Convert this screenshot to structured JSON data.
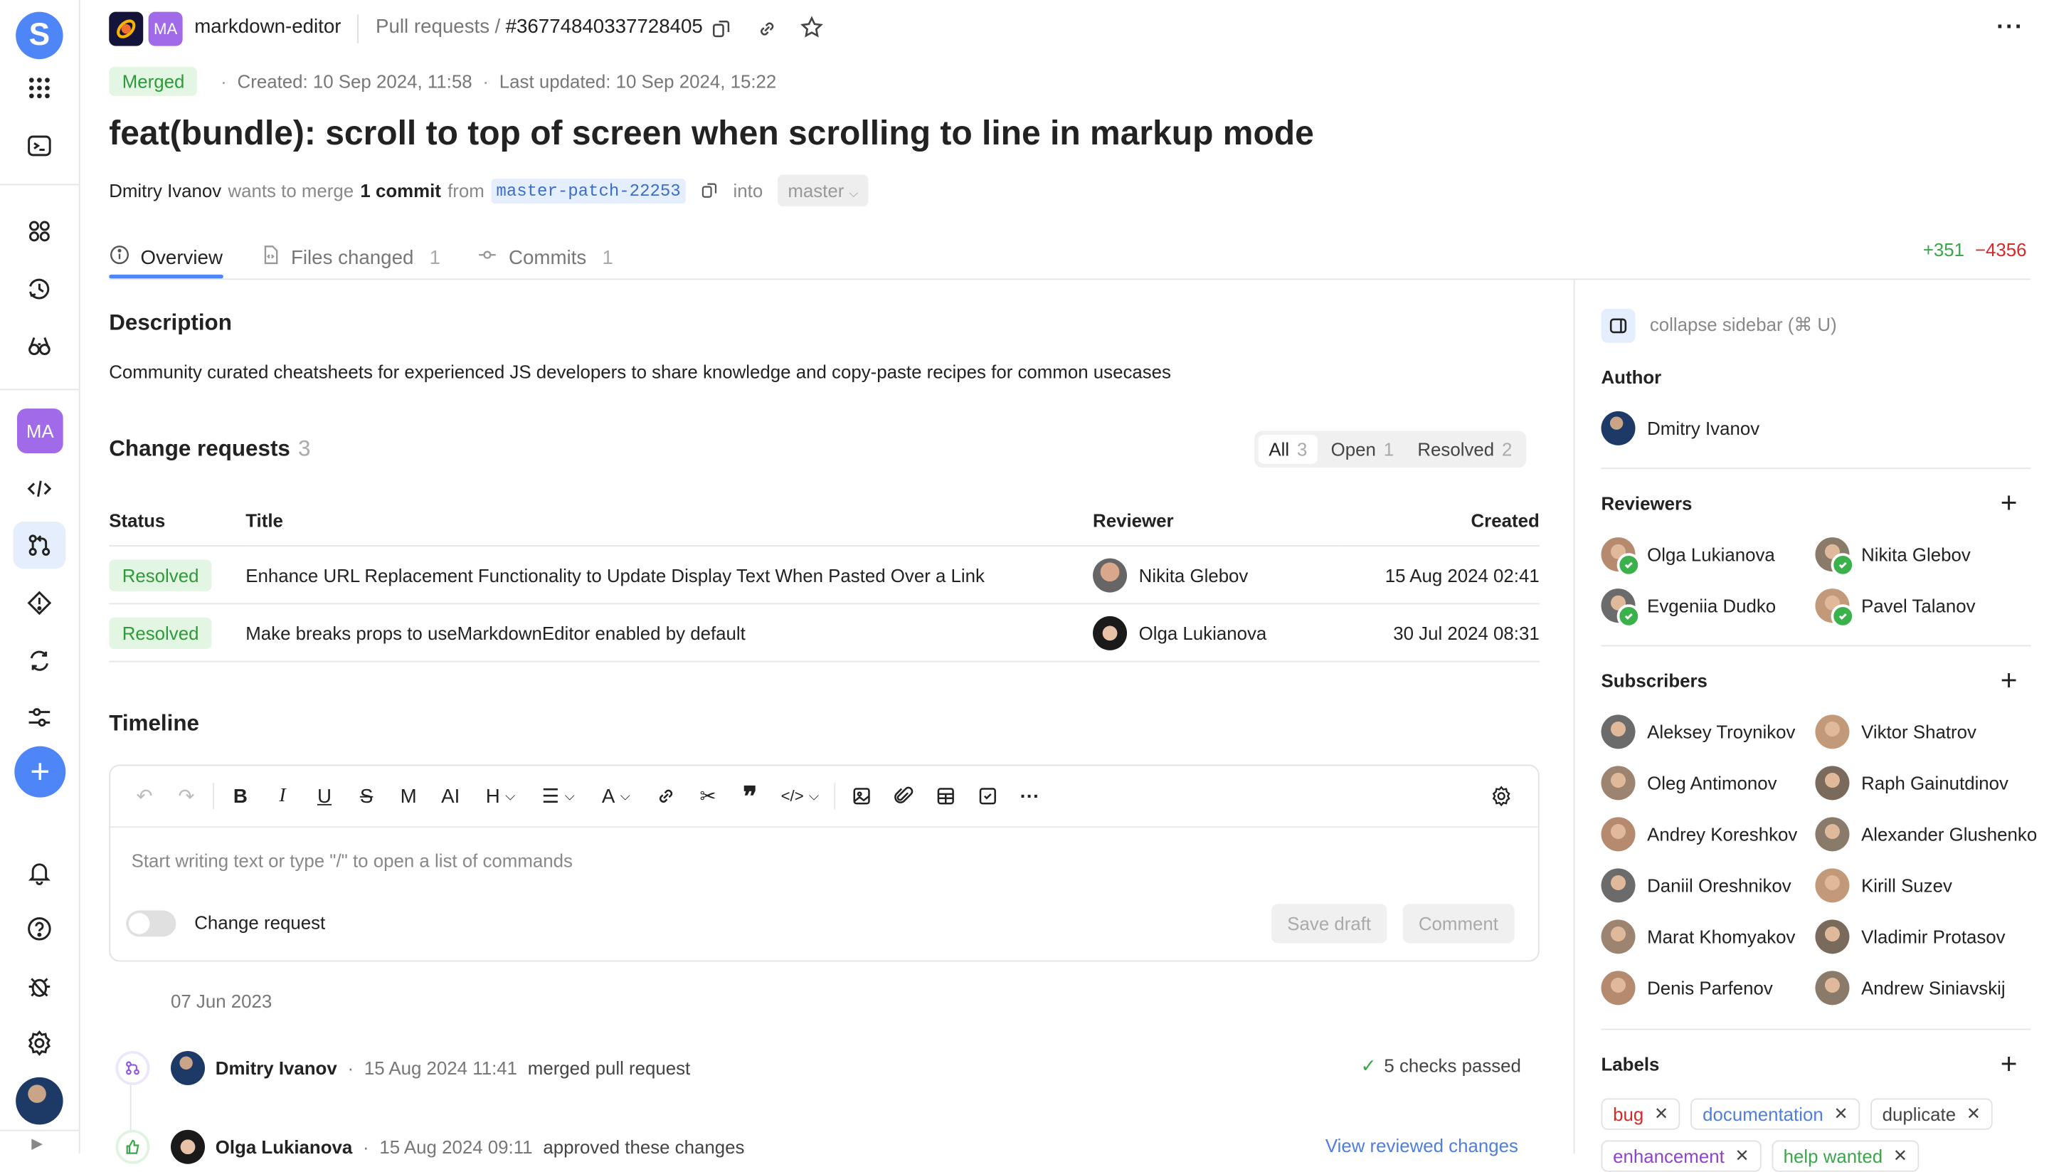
{
  "nav": {
    "logo": "S",
    "project_badge": "MA",
    "items": [
      {
        "name": "apps-grid-icon"
      },
      {
        "name": "terminal-icon"
      },
      {
        "name": "dashboard-icon"
      },
      {
        "name": "history-icon"
      },
      {
        "name": "binoculars-icon"
      },
      {
        "name": "code-icon"
      },
      {
        "name": "pull-requests-icon",
        "active": true
      },
      {
        "name": "issues-icon"
      },
      {
        "name": "ci-cd-icon"
      },
      {
        "name": "settings-sliders-icon"
      },
      {
        "name": "bell-icon"
      },
      {
        "name": "help-icon"
      },
      {
        "name": "bug-report-icon"
      },
      {
        "name": "gear-icon"
      }
    ],
    "create_label": "+"
  },
  "header": {
    "project_badge": "MA",
    "repo_name": "markdown-editor",
    "breadcrumb_section": "Pull requests",
    "breadcrumb_sep": "/",
    "pr_number": "#36774840337728405"
  },
  "pr": {
    "status": "Merged",
    "created": "Created: 10 Sep 2024, 11:58",
    "updated": "Last updated: 10 Sep 2024, 15:22",
    "title": "feat(bundle): scroll to top of screen when scrolling to line in markup mode",
    "author": "Dmitry Ivanov",
    "wants_to_merge": "wants to merge",
    "commit_count": "1 commit",
    "from": "from",
    "source_branch": "master-patch-22253",
    "into": "into",
    "target_branch": "master",
    "additions": "+351",
    "deletions": "−4356"
  },
  "tabs": [
    {
      "label": "Overview",
      "count": ""
    },
    {
      "label": "Files changed",
      "count": "1"
    },
    {
      "label": "Commits",
      "count": "1"
    }
  ],
  "description": {
    "heading": "Description",
    "text": "Community curated cheatsheets for experienced JS developers to share knowledge and copy-paste recipes for common usecases"
  },
  "change_requests": {
    "heading": "Change requests",
    "count": "3",
    "filters": [
      {
        "label": "All",
        "count": "3",
        "active": true
      },
      {
        "label": "Open",
        "count": "1"
      },
      {
        "label": "Resolved",
        "count": "2"
      }
    ],
    "columns": [
      "Status",
      "Title",
      "Reviewer",
      "Created"
    ],
    "rows": [
      {
        "status": "Resolved",
        "title": "Enhance URL Replacement Functionality to Update Display Text When Pasted Over a Link",
        "reviewer": "Nikita Glebov",
        "created": "15 Aug 2024 02:41"
      },
      {
        "status": "Resolved",
        "title": "Make breaks props to useMarkdownEditor enabled by default",
        "reviewer": "Olga Lukianova",
        "created": "30 Jul 2024 08:31"
      }
    ]
  },
  "timeline": {
    "heading": "Timeline",
    "editor": {
      "placeholder": "Start writing text or type \"/\" to open a list of commands",
      "toggle_label": "Change request",
      "save_draft": "Save draft",
      "comment": "Comment"
    },
    "date": "07 Jun 2023",
    "events": [
      {
        "author": "Dmitry Ivanov",
        "time": "15 Aug 2024 11:41",
        "action": "merged pull request",
        "right": "5 checks passed"
      },
      {
        "author": "Olga Lukianova",
        "time": "15 Aug 2024 09:11",
        "action": "approved these changes",
        "right": "View reviewed changes"
      }
    ]
  },
  "sidebar": {
    "collapse_label": "collapse sidebar (⌘ U)",
    "author_heading": "Author",
    "author": "Dmitry Ivanov",
    "reviewers_heading": "Reviewers",
    "reviewers": [
      "Olga Lukianova",
      "Nikita Glebov",
      "Evgeniia Dudko",
      "Pavel Talanov"
    ],
    "subscribers_heading": "Subscribers",
    "subscribers": [
      "Aleksey Troynikov",
      "Viktor Shatrov",
      "Oleg Antimonov",
      "Raph Gainutdinov",
      "Andrey Koreshkov",
      "Alexander Glushenko",
      "Daniil Oreshnikov",
      "Kirill Suzev",
      "Marat Khomyakov",
      "Vladimir Protasov",
      "Denis Parfenov",
      "Andrew Siniavskij"
    ],
    "labels_heading": "Labels",
    "labels": [
      {
        "text": "bug",
        "color": "#d42a2a"
      },
      {
        "text": "documentation",
        "color": "#4f7fd9"
      },
      {
        "text": "duplicate",
        "color": "#444444"
      },
      {
        "text": "enhancement",
        "color": "#8e44c9"
      },
      {
        "text": "help wanted",
        "color": "#3aa64a"
      }
    ]
  },
  "colors": {
    "accent": "#4f86f7",
    "success": "#3aa64a",
    "danger": "#d42a2a",
    "merged_bg": "#e3f5e3"
  }
}
